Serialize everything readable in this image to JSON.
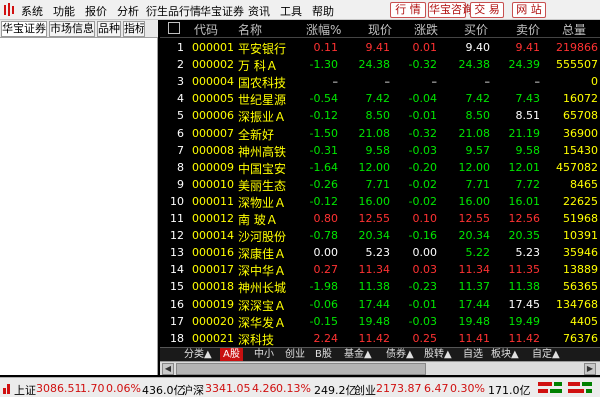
{
  "menu": {
    "items": [
      "系统",
      "功能",
      "报价",
      "分析",
      "衍生品行情",
      "华宝证券",
      "资讯",
      "工具",
      "帮助"
    ],
    "quick_buttons": [
      "行 情",
      "华宝咨询",
      "交 易",
      "网 站"
    ]
  },
  "left_panel": {
    "tabs": [
      "华宝证券",
      "市场信息",
      "品种",
      "指标"
    ]
  },
  "table": {
    "headers": [
      "代码",
      "名称",
      "涨幅%",
      "现价",
      "涨跌",
      "买价",
      "卖价",
      "总量"
    ],
    "rows": [
      {
        "idx": "1",
        "code": "000001",
        "name": "平安银行",
        "pct": "0.11",
        "price": "9.41",
        "chg": "0.01",
        "bid": "9.40",
        "ask": "9.41",
        "vol": "219866",
        "c": [
          "red",
          "red",
          "red",
          "white",
          "red",
          "red"
        ]
      },
      {
        "idx": "2",
        "code": "000002",
        "name": "万 科Ａ",
        "pct": "-1.30",
        "price": "24.38",
        "chg": "-0.32",
        "bid": "24.38",
        "ask": "24.39",
        "vol": "555507",
        "c": [
          "green",
          "green",
          "green",
          "green",
          "green",
          "yellow"
        ]
      },
      {
        "idx": "3",
        "code": "000004",
        "name": "国农科技",
        "pct": "–",
        "price": "–",
        "chg": "–",
        "bid": "–",
        "ask": "–",
        "vol": "0",
        "c": [
          "white",
          "white",
          "white",
          "white",
          "white",
          "yellow"
        ]
      },
      {
        "idx": "4",
        "code": "000005",
        "name": "世纪星源",
        "pct": "-0.54",
        "price": "7.42",
        "chg": "-0.04",
        "bid": "7.42",
        "ask": "7.43",
        "vol": "16072",
        "c": [
          "green",
          "green",
          "green",
          "green",
          "green",
          "yellow"
        ]
      },
      {
        "idx": "5",
        "code": "000006",
        "name": "深振业Ａ",
        "pct": "-0.12",
        "price": "8.50",
        "chg": "-0.01",
        "bid": "8.50",
        "ask": "8.51",
        "vol": "65708",
        "c": [
          "green",
          "green",
          "green",
          "green",
          "white",
          "yellow"
        ]
      },
      {
        "idx": "6",
        "code": "000007",
        "name": "全新好",
        "pct": "-1.50",
        "price": "21.08",
        "chg": "-0.32",
        "bid": "21.08",
        "ask": "21.19",
        "vol": "36900",
        "c": [
          "green",
          "green",
          "green",
          "green",
          "green",
          "yellow"
        ]
      },
      {
        "idx": "7",
        "code": "000008",
        "name": "神州高铁",
        "pct": "-0.31",
        "price": "9.58",
        "chg": "-0.03",
        "bid": "9.57",
        "ask": "9.58",
        "vol": "15430",
        "c": [
          "green",
          "green",
          "green",
          "green",
          "green",
          "yellow"
        ]
      },
      {
        "idx": "8",
        "code": "000009",
        "name": "中国宝安",
        "pct": "-1.64",
        "price": "12.00",
        "chg": "-0.20",
        "bid": "12.00",
        "ask": "12.01",
        "vol": "457082",
        "c": [
          "green",
          "green",
          "green",
          "green",
          "green",
          "yellow"
        ]
      },
      {
        "idx": "9",
        "code": "000010",
        "name": "美丽生态",
        "pct": "-0.26",
        "price": "7.71",
        "chg": "-0.02",
        "bid": "7.71",
        "ask": "7.72",
        "vol": "8465",
        "c": [
          "green",
          "green",
          "green",
          "green",
          "green",
          "yellow"
        ]
      },
      {
        "idx": "10",
        "code": "000011",
        "name": "深物业Ａ",
        "pct": "-0.12",
        "price": "16.00",
        "chg": "-0.02",
        "bid": "16.00",
        "ask": "16.01",
        "vol": "22625",
        "c": [
          "green",
          "green",
          "green",
          "green",
          "green",
          "yellow"
        ]
      },
      {
        "idx": "11",
        "code": "000012",
        "name": "南 玻Ａ",
        "pct": "0.80",
        "price": "12.55",
        "chg": "0.10",
        "bid": "12.55",
        "ask": "12.56",
        "vol": "51968",
        "c": [
          "red",
          "red",
          "red",
          "red",
          "red",
          "yellow"
        ]
      },
      {
        "idx": "12",
        "code": "000014",
        "name": "沙河股份",
        "pct": "-0.78",
        "price": "20.34",
        "chg": "-0.16",
        "bid": "20.34",
        "ask": "20.35",
        "vol": "10391",
        "c": [
          "green",
          "green",
          "green",
          "green",
          "green",
          "yellow"
        ]
      },
      {
        "idx": "13",
        "code": "000016",
        "name": "深康佳Ａ",
        "pct": "0.00",
        "price": "5.23",
        "chg": "0.00",
        "bid": "5.22",
        "ask": "5.23",
        "vol": "35946",
        "c": [
          "white",
          "white",
          "white",
          "green",
          "white",
          "yellow"
        ]
      },
      {
        "idx": "14",
        "code": "000017",
        "name": "深中华Ａ",
        "pct": "0.27",
        "price": "11.34",
        "chg": "0.03",
        "bid": "11.34",
        "ask": "11.35",
        "vol": "13889",
        "c": [
          "red",
          "red",
          "red",
          "red",
          "red",
          "yellow"
        ]
      },
      {
        "idx": "15",
        "code": "000018",
        "name": "神州长城",
        "pct": "-1.98",
        "price": "11.38",
        "chg": "-0.23",
        "bid": "11.37",
        "ask": "11.38",
        "vol": "56365",
        "c": [
          "green",
          "green",
          "green",
          "green",
          "green",
          "yellow"
        ]
      },
      {
        "idx": "16",
        "code": "000019",
        "name": "深深宝Ａ",
        "pct": "-0.06",
        "price": "17.44",
        "chg": "-0.01",
        "bid": "17.44",
        "ask": "17.45",
        "vol": "134768",
        "c": [
          "green",
          "green",
          "green",
          "green",
          "white",
          "yellow"
        ]
      },
      {
        "idx": "17",
        "code": "000020",
        "name": "深华发Ａ",
        "pct": "-0.15",
        "price": "19.48",
        "chg": "-0.03",
        "bid": "19.48",
        "ask": "19.49",
        "vol": "4405",
        "c": [
          "green",
          "green",
          "green",
          "green",
          "green",
          "yellow"
        ]
      },
      {
        "idx": "18",
        "code": "000021",
        "name": "深科技",
        "pct": "2.24",
        "price": "11.42",
        "chg": "0.25",
        "bid": "11.41",
        "ask": "11.42",
        "vol": "76376",
        "c": [
          "red",
          "red",
          "red",
          "red",
          "red",
          "yellow"
        ]
      }
    ]
  },
  "bottom_tabs": [
    "分类▲",
    "A股",
    "中小",
    "创业",
    "B股",
    "基金▲",
    "债券▲",
    "股转▲",
    "自选",
    "板块▲",
    "自定▲"
  ],
  "status": {
    "sh_label": "上证",
    "sh_index": "3086.51",
    "sh_chg": "1.70",
    "sh_pct": "0.06%",
    "sh_amt": "436.0亿",
    "sz_label": "沪深",
    "sz_index": "3341.05",
    "sz_chg": "4.26",
    "sz_pct": "0.13%",
    "sz_amt": "249.2亿",
    "cy_label": "创业",
    "cy_index": "2173.87",
    "cy_chg": "6.47",
    "cy_pct": "0.30%",
    "cy_amt": "171.0亿"
  },
  "colors": {
    "up": "#ff3232",
    "down": "#00e600",
    "code": "#ffff00",
    "background": "#000000",
    "accent": "#c81010"
  }
}
